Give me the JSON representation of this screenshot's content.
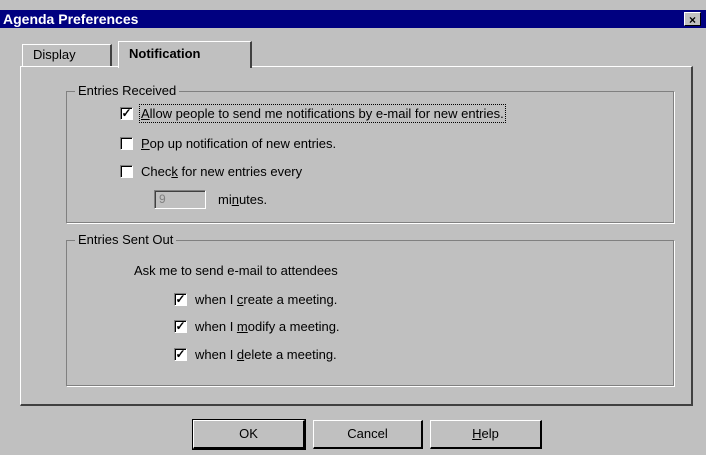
{
  "window": {
    "title": "Agenda Preferences",
    "close_glyph": "×"
  },
  "tabs": [
    {
      "label": "Display",
      "active": false
    },
    {
      "label": "Notification",
      "active": true
    }
  ],
  "entries_received": {
    "legend": "Entries Received",
    "allow_email": {
      "mnemonic": "A",
      "rest": "llow people to send me notifications by e-mail for new entries.",
      "checked": true
    },
    "popup": {
      "mnemonic": "P",
      "rest": "op up notification of new entries.",
      "checked": false
    },
    "check": {
      "pre": "Chec",
      "mnemonic": "k",
      "rest": " for new entries every",
      "checked": false
    },
    "minutes_value": "9",
    "minutes": {
      "pre": "mi",
      "mnemonic": "n",
      "rest": "utes."
    }
  },
  "entries_sent": {
    "legend": "Entries Sent Out",
    "prompt": "Ask me to send e-mail to attendees",
    "create": {
      "pre": "when I ",
      "mnemonic": "c",
      "rest": "reate a meeting.",
      "checked": true
    },
    "modify": {
      "pre": "when I ",
      "mnemonic": "m",
      "rest": "odify a meeting.",
      "checked": true
    },
    "delete": {
      "pre": "when I ",
      "mnemonic": "d",
      "rest": "elete a meeting.",
      "checked": true
    }
  },
  "buttons": {
    "ok": "OK",
    "cancel": "Cancel",
    "help": {
      "mnemonic": "H",
      "rest": "elp"
    }
  },
  "check_glyph": "✓"
}
